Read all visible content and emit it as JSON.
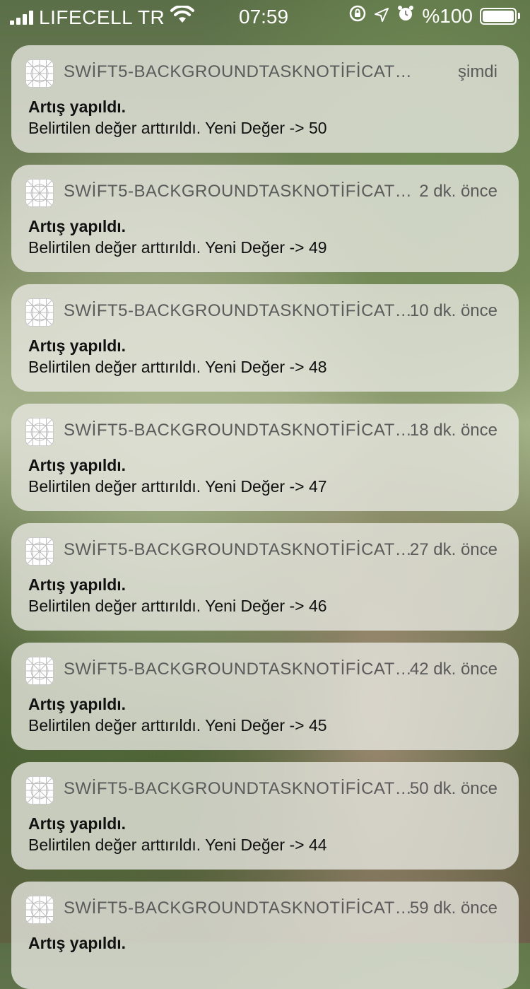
{
  "status_bar": {
    "carrier": "LIFECELL TR",
    "time": "07:59",
    "battery": "%100",
    "icons": [
      "signal-icon",
      "wifi-icon",
      "rotation-lock-icon",
      "location-icon",
      "alarm-icon",
      "battery-icon"
    ]
  },
  "notifications": [
    {
      "app": "SWİFT5-BACKGROUNDTASKNOTİFİCATİON",
      "time": "şimdi",
      "title": "Artış yapıldı.",
      "body": "Belirtilen değer arttırıldı. Yeni Değer -> 50"
    },
    {
      "app": "SWİFT5-BACKGROUNDTASKNOTİFİCATİON",
      "time": "2 dk. önce",
      "title": "Artış yapıldı.",
      "body": "Belirtilen değer arttırıldı. Yeni Değer -> 49"
    },
    {
      "app": "SWİFT5-BACKGROUNDTASKNOTİFİCATİ...",
      "time": "10 dk. önce",
      "title": "Artış yapıldı.",
      "body": "Belirtilen değer arttırıldı. Yeni Değer -> 48"
    },
    {
      "app": "SWİFT5-BACKGROUNDTASKNOTİFİCATİ...",
      "time": "18 dk. önce",
      "title": "Artış yapıldı.",
      "body": "Belirtilen değer arttırıldı. Yeni Değer -> 47"
    },
    {
      "app": "SWİFT5-BACKGROUNDTASKNOTİFİCATİ...",
      "time": "27 dk. önce",
      "title": "Artış yapıldı.",
      "body": "Belirtilen değer arttırıldı. Yeni Değer -> 46"
    },
    {
      "app": "SWİFT5-BACKGROUNDTASKNOTİFİCATİ...",
      "time": "42 dk. önce",
      "title": "Artış yapıldı.",
      "body": "Belirtilen değer arttırıldı. Yeni Değer -> 45"
    },
    {
      "app": "SWİFT5-BACKGROUNDTASKNOTİFİCATİ...",
      "time": "50 dk. önce",
      "title": "Artış yapıldı.",
      "body": "Belirtilen değer arttırıldı. Yeni Değer -> 44"
    },
    {
      "app": "SWİFT5-BACKGROUNDTASKNOTİFİCATİ...",
      "time": "59 dk. önce",
      "title": "Artış yapıldı.",
      "body": ""
    }
  ]
}
